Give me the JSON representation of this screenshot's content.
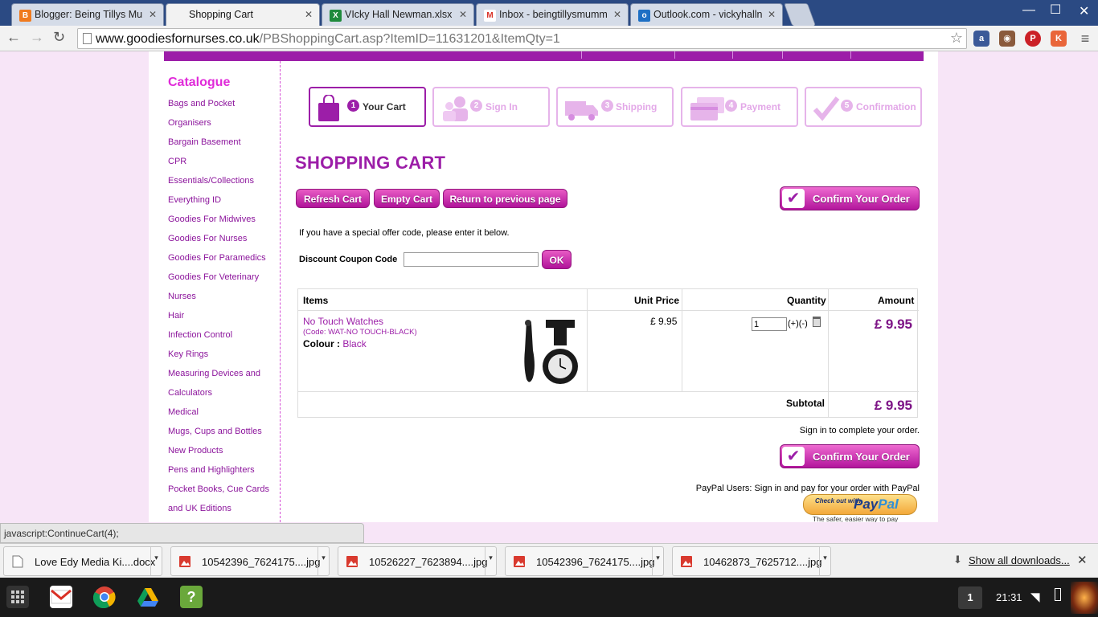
{
  "browser": {
    "tabs": [
      {
        "title": "Blogger: Being Tillys Mu",
        "favicon": "blogger-icon",
        "color": "#f07a1e"
      },
      {
        "title": "Shopping Cart",
        "favicon": "blank-page-icon",
        "color": "#ffffff"
      },
      {
        "title": "VIcky Hall Newman.xlsx",
        "favicon": "excel-icon",
        "color": "#1f8a3c"
      },
      {
        "title": "Inbox - beingtillysmumm",
        "favicon": "gmail-icon",
        "color": "#d93025"
      },
      {
        "title": "Outlook.com - vickyhalln",
        "favicon": "outlook-icon",
        "color": "#1d6fc4"
      }
    ],
    "url_host": "www.goodiesfornurses.co.uk",
    "url_path": "/PBShoppingCart.asp?ItemID=11631201&ItemQty=1"
  },
  "sidebar": {
    "title": "Catalogue",
    "items": [
      "Bags and Pocket",
      "Organisers",
      "Bargain Basement",
      "CPR",
      "Essentials/Collections",
      "Everything ID",
      "Goodies For Midwives",
      "Goodies For Nurses",
      "Goodies For Paramedics",
      "Goodies For Veterinary",
      "Nurses",
      "Hair",
      "Infection Control",
      "Key Rings",
      "Measuring Devices and",
      "Calculators",
      "Medical",
      "Mugs, Cups and Bottles",
      "New Products",
      "Pens and Highlighters",
      "Pocket Books, Cue Cards",
      "and UK Editions"
    ]
  },
  "steps": [
    {
      "num": "1",
      "label": "Your Cart"
    },
    {
      "num": "2",
      "label": "Sign In"
    },
    {
      "num": "3",
      "label": "Shipping"
    },
    {
      "num": "4",
      "label": "Payment"
    },
    {
      "num": "5",
      "label": "Confirmation"
    }
  ],
  "cart": {
    "heading": "SHOPPING CART",
    "refresh_label": "Refresh Cart",
    "empty_label": "Empty Cart",
    "return_label": "Return to previous page",
    "confirm_label": "Confirm Your Order",
    "offer_text": "If you have a special offer code, please enter it below.",
    "coupon_label": "Discount Coupon Code",
    "coupon_value": "",
    "ok_label": "OK",
    "columns": {
      "items": "Items",
      "unit_price": "Unit Price",
      "quantity": "Quantity",
      "amount": "Amount"
    },
    "item": {
      "name": "No Touch Watches",
      "code": "(Code: WAT-NO TOUCH-BLACK)",
      "colour_label": "Colour :",
      "colour": "Black",
      "unit_price": "£ 9.95",
      "quantity": "1",
      "qty_controls": "(+)(-)",
      "amount": "£ 9.95"
    },
    "subtotal_label": "Subtotal",
    "subtotal": "£ 9.95",
    "signin_note": "Sign in to complete your order.",
    "paypal_note": "PayPal Users: Sign in and pay for your order with PayPal",
    "paypal_btn_small": "Check out with",
    "paypal_brand_a": "Pay",
    "paypal_brand_b": "Pal",
    "paypal_tagline": "The safer, easier way to pay"
  },
  "status_text": "javascript:ContinueCart(4);",
  "downloads": {
    "items": [
      {
        "name": "Love Edy Media Ki....docx",
        "icon": "document-icon"
      },
      {
        "name": "10542396_7624175....jpg",
        "icon": "image-icon"
      },
      {
        "name": "10526227_7623894....jpg",
        "icon": "image-icon"
      },
      {
        "name": "10542396_7624175....jpg",
        "icon": "image-icon"
      },
      {
        "name": "10462873_7625712....jpg",
        "icon": "image-icon"
      }
    ],
    "show_all": "Show all downloads..."
  },
  "taskbar": {
    "badge": "1",
    "time": "21:31"
  }
}
